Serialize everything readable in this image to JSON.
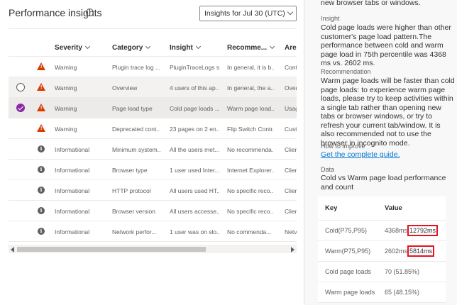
{
  "header": {
    "title": "Performance insights",
    "info_icon": "info-icon",
    "date_dropdown": "Insights for Jul 30 (UTC)"
  },
  "grid": {
    "columns": [
      "Severity",
      "Category",
      "Insight",
      "Recomme...",
      "Area"
    ],
    "rows": [
      {
        "severity": "Warning",
        "category": "Plugin trace log ...",
        "insight": "PluginTraceLogs s...",
        "recommendation": "In general, it is b...",
        "area": "Cont",
        "icon": "warning-icon"
      },
      {
        "severity": "Warning",
        "category": "Overview",
        "insight": "4 users of this ap...",
        "recommendation": "In general, the a...",
        "area": "Over",
        "icon": "warning-icon"
      },
      {
        "severity": "Warning",
        "category": "Page load type",
        "insight": "Cold page loads ...",
        "recommendation": "Warm page load...",
        "area": "Usag",
        "icon": "warning-icon"
      },
      {
        "severity": "Warning",
        "category": "Deprecated cont...",
        "insight": "23 pages on 2 en...",
        "recommendation": "Flip Switch Contr...",
        "area": "Cust",
        "icon": "warning-icon"
      },
      {
        "severity": "Informational",
        "category": "Minimum system...",
        "insight": "All the users met...",
        "recommendation": "No recommenda...",
        "area": "Clien",
        "icon": "info-icon"
      },
      {
        "severity": "Informational",
        "category": "Browser type",
        "insight": "1 user used Inter...",
        "recommendation": "Internet Explorer...",
        "area": "Clien",
        "icon": "info-icon"
      },
      {
        "severity": "Informational",
        "category": "HTTP protocol",
        "insight": "All users used HT...",
        "recommendation": "No specific reco...",
        "area": "Clien",
        "icon": "info-icon"
      },
      {
        "severity": "Informational",
        "category": "Browser version",
        "insight": "All users accesse...",
        "recommendation": "No specific reco...",
        "area": "Clien",
        "icon": "info-icon"
      },
      {
        "severity": "Informational",
        "category": "Network perfor...",
        "insight": "1 user was on slo...",
        "recommendation": "No commenda...",
        "area": "Netv",
        "icon": "info-icon"
      }
    ]
  },
  "details": {
    "top_text": "new browser tabs or windows.",
    "insight_label": "Insight",
    "insight_text": "Cold page loads were higher than other customer's page load pattern.The performance between cold and warm page load in 75th percentile was 4368 ms vs. 2602 ms.",
    "recommendation_label": "Recommendation",
    "recommendation_text": "Warm page loads will be faster than cold page loads: to experience warm page loads, please try to keep activities within a single tab rather than opening new tabs or browser windows, or try to refresh your current tab/window. It is also recommended not to use the browser in incognito mode.",
    "improve_label": "How to improve",
    "improve_link": "Get the complete guide.",
    "data_label": "Data",
    "data_title": "Cold vs Warm page load performance and count",
    "table": {
      "key_header": "Key",
      "value_header": "Value",
      "rows": [
        {
          "key": "Cold(P75,P95)",
          "v1": "4368ms",
          "v2": "12792ms"
        },
        {
          "key": "Warm(P75,P95)",
          "v1": "2602ms",
          "v2": "5814ms"
        },
        {
          "key": "Cold page loads",
          "v1": "70 (51.85%)",
          "v2": ""
        },
        {
          "key": "Warm page loads",
          "v1": "65 (48.15%)",
          "v2": ""
        }
      ]
    }
  },
  "colors": {
    "warning": "#d83b01",
    "accent": "#8a2aa5",
    "link": "#0078d4",
    "highlight": "#e81123"
  }
}
